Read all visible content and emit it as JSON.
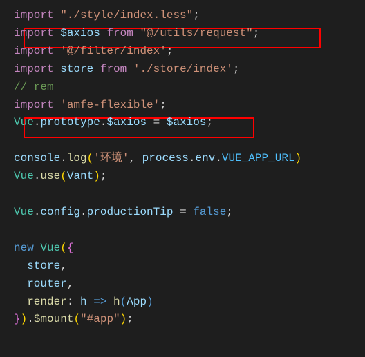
{
  "code": {
    "line1": {
      "import": "import",
      "string": "\"./style/index.less\"",
      "semi": ";"
    },
    "line2": {
      "import": "import",
      "var": "$axios",
      "from": "from",
      "string": "\"@/utils/request\"",
      "semi": ";"
    },
    "line3": {
      "import": "import",
      "string": "'@/filter/index'",
      "semi": ";"
    },
    "line4": {
      "import": "import",
      "var": "store",
      "from": "from",
      "string": "'./store/index'",
      "semi": ";"
    },
    "line5": {
      "comment": "// rem"
    },
    "line6": {
      "import": "import",
      "string": "'amfe-flexible'",
      "semi": ";"
    },
    "line7": {
      "vue": "Vue",
      "dot1": ".",
      "prototype": "prototype",
      "dot2": ".",
      "axios": "$axios",
      "eq": " = ",
      "axiosval": "$axios",
      "semi": ";"
    },
    "line8": {
      "console": "console",
      "dot": ".",
      "log": "log",
      "lp": "(",
      "string": "'环境'",
      "comma": ", ",
      "process": "process",
      "dot2": ".",
      "env": "env",
      "dot3": ".",
      "url": "VUE_APP_URL",
      "rp": ")"
    },
    "line9": {
      "vue": "Vue",
      "dot": ".",
      "use": "use",
      "lp": "(",
      "vant": "Vant",
      "rp": ")",
      "semi": ";"
    },
    "line10": {
      "vue": "Vue",
      "dot": ".",
      "config": "config",
      "dot2": ".",
      "ptip": "productionTip",
      "eq": " = ",
      "false": "false",
      "semi": ";"
    },
    "line11": {
      "new": "new",
      "vue": "Vue",
      "lp": "(",
      "lb": "{"
    },
    "line12": {
      "indent": "  ",
      "store": "store",
      "comma": ","
    },
    "line13": {
      "indent": "  ",
      "router": "router",
      "comma": ","
    },
    "line14": {
      "indent": "  ",
      "render": "render",
      "colon": ":",
      "sp": " ",
      "h": "h",
      "arrow": " => ",
      "hfn": "h",
      "lp": "(",
      "app": "App",
      "rp": ")"
    },
    "line15": {
      "rb": "}",
      "rp": ")",
      "dot": ".",
      "mount": "$mount",
      "lp": "(",
      "string": "\"#app\"",
      "rp2": ")",
      "semi": ";"
    }
  }
}
